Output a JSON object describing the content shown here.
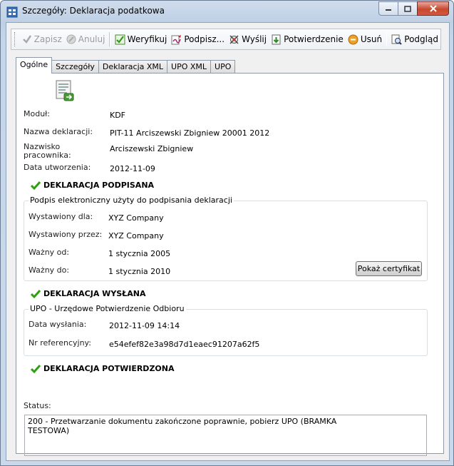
{
  "window": {
    "title": "Szczegóły: Deklaracja podatkowa"
  },
  "toolbar": {
    "save": "Zapisz",
    "cancel": "Anuluj",
    "verify": "Weryfikuj",
    "sign": "Podpisz...",
    "send": "Wyślij",
    "confirm": "Potwierdzenie",
    "delete": "Usuń",
    "preview": "Podgląd"
  },
  "tabs": [
    "Ogólne",
    "Szczegóły",
    "Deklaracja XML",
    "UPO XML",
    "UPO"
  ],
  "general": {
    "module_label": "Moduł:",
    "module_value": "KDF",
    "name_label": "Nazwa deklaracji:",
    "name_value": "PIT-11 Arciszewski Zbigniew 20001 2012",
    "employee_label_1": "Nazwisko",
    "employee_label_2": "pracownika:",
    "employee_value": "Arciszewski Zbigniew",
    "created_label": "Data utworzenia:",
    "created_value": "2012-11-09"
  },
  "signed": {
    "heading": "DEKLARACJA PODPISANA",
    "group_title": "Podpis elektroniczny użyty do podpisania deklaracji",
    "issued_to_label": "Wystawiony dla:",
    "issued_to_value": "XYZ Company",
    "issued_by_label": "Wystawiony przez:",
    "issued_by_value": "XYZ Company",
    "valid_from_label": "Ważny od:",
    "valid_from_value": "1 stycznia 2005",
    "valid_to_label": "Ważny do:",
    "valid_to_value": "1 stycznia 2010",
    "cert_button": "Pokaż certyfikat"
  },
  "sent": {
    "heading": "DEKLARACJA WYSŁANA",
    "group_title": "UPO - Urzędowe Potwierdzenie Odbioru",
    "date_label": "Data wysłania:",
    "date_value": "2012-11-09 14:14",
    "ref_label": "Nr referencyjny:",
    "ref_value": "e54efef82e3a98d7d1eaec91207a62f5"
  },
  "confirmed": {
    "heading": "DEKLARACJA POTWIERDZONA",
    "status_label": "Status:",
    "status_text": "200 - Przetwarzanie dokumentu zakończone poprawnie, pobierz UPO (BRAMKA\nTESTOWA)"
  },
  "icons": [
    "app-icon",
    "minimize-icon",
    "maximize-icon",
    "close-icon",
    "save-icon",
    "cancel-icon",
    "verify-icon",
    "sign-icon",
    "send-icon",
    "confirm-icon",
    "delete-icon",
    "preview-icon",
    "document-icon",
    "check-icon"
  ]
}
